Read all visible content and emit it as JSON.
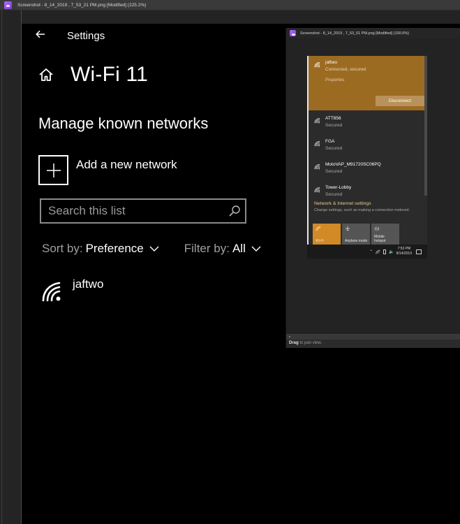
{
  "outer_window": {
    "title": "Screenshot - 8_14_2019 , 7_53_21 PM.png [Modified] (225.2%)",
    "app_icon": "image-editor-icon"
  },
  "settings": {
    "back_icon": "back-arrow-icon",
    "app_label": "Settings",
    "home_icon": "home-icon",
    "page_title": "Wi-Fi 11",
    "section_title": "Manage known networks",
    "add_network": {
      "icon": "plus-icon",
      "label": "Add a new network"
    },
    "search": {
      "placeholder": "Search this list",
      "value": "",
      "icon": "search-icon"
    },
    "sort": {
      "label": "Sort by:",
      "value": "Preference"
    },
    "filter": {
      "label": "Filter by:",
      "value": "All"
    },
    "networks": [
      {
        "name": "jaftwo",
        "icon": "wifi-icon"
      }
    ]
  },
  "inner_window": {
    "title": "Screenshot - 8_14_2019 , 7_53_01 PM.png [Modified] (100.0%)",
    "status": {
      "bold": "Drag",
      "rest": "to pan view."
    },
    "flyout": {
      "connected": {
        "name": "jaftwo",
        "status": "Connected, secured",
        "properties": "Properties",
        "disconnect": "Disconnect"
      },
      "networks": [
        {
          "name": "ATT856",
          "status": "Secured"
        },
        {
          "name": "FGA",
          "status": "Secured"
        },
        {
          "name": "MotoVAP_M91720SC06PQ",
          "status": "Secured"
        },
        {
          "name": "Tower-Lobby",
          "status": "Secured"
        }
      ],
      "settings_link": {
        "title": "Network & Internet settings",
        "description": "Change settings, such as making a connection metered."
      },
      "tiles": [
        {
          "label": "Wi-Fi",
          "active": true,
          "icon": "wifi-icon"
        },
        {
          "label": "Airplane mode",
          "active": false,
          "icon": "airplane-icon"
        },
        {
          "label": "Mobile hotspot",
          "active": false,
          "icon": "hotspot-icon"
        }
      ],
      "taskbar": {
        "time": "7:53 PM",
        "date": "8/14/2019"
      }
    }
  },
  "colors": {
    "accent_connected": "#9c6b22",
    "accent_tile": "#d18a26",
    "settings_bg": "#000000",
    "viewer_bg": "#232323"
  }
}
